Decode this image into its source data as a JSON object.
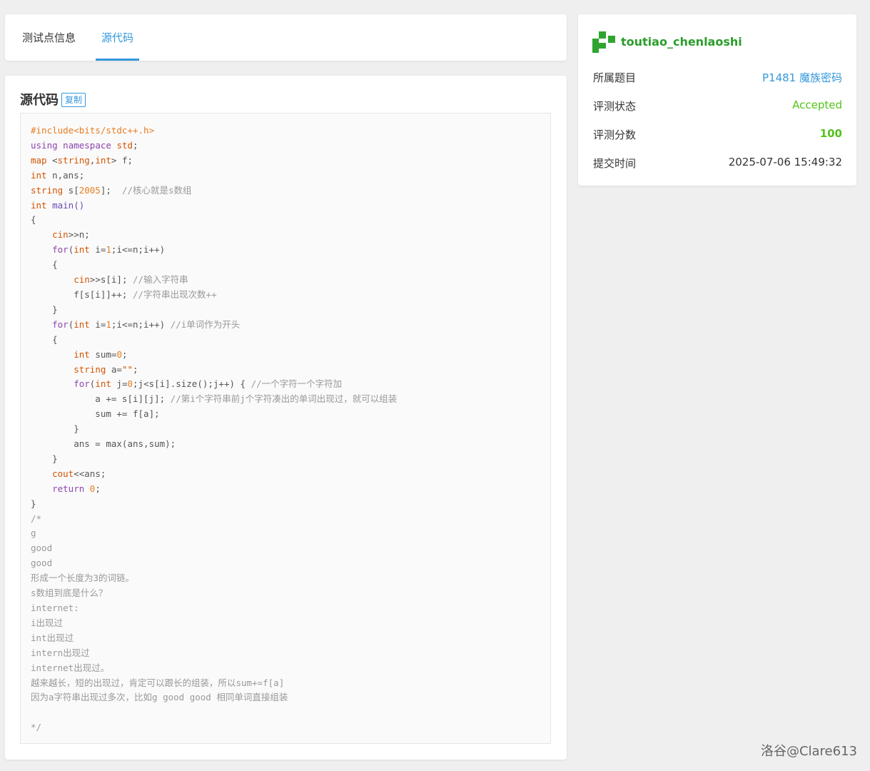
{
  "tabs": [
    {
      "label": "测试点信息"
    },
    {
      "label": "源代码"
    }
  ],
  "source": {
    "title": "源代码",
    "copy_label": "复制"
  },
  "code_lines": [
    [
      [
        "pre",
        "#include<bits/stdc++.h>"
      ]
    ],
    [
      [
        "kw",
        "using"
      ],
      [
        "plain",
        " "
      ],
      [
        "kw",
        "namespace"
      ],
      [
        "plain",
        " "
      ],
      [
        "ty",
        "std"
      ],
      [
        "plain",
        ";"
      ]
    ],
    [
      [
        "ty",
        "map"
      ],
      [
        "plain",
        " <"
      ],
      [
        "ty",
        "string"
      ],
      [
        "plain",
        ","
      ],
      [
        "ty",
        "int"
      ],
      [
        "plain",
        "> f;"
      ]
    ],
    [
      [
        "ty",
        "int"
      ],
      [
        "plain",
        " n,ans;"
      ]
    ],
    [
      [
        "ty",
        "string"
      ],
      [
        "plain",
        " s["
      ],
      [
        "num",
        "2005"
      ],
      [
        "plain",
        "];  "
      ],
      [
        "com",
        "//核心就是s数组"
      ]
    ],
    [
      [
        "ty",
        "int"
      ],
      [
        "plain",
        " "
      ],
      [
        "fn",
        "main()"
      ]
    ],
    [
      [
        "plain",
        "{"
      ]
    ],
    [
      [
        "plain",
        "    "
      ],
      [
        "ty",
        "cin"
      ],
      [
        "plain",
        ">>n;"
      ]
    ],
    [
      [
        "plain",
        "    "
      ],
      [
        "kw",
        "for"
      ],
      [
        "plain",
        "("
      ],
      [
        "ty",
        "int"
      ],
      [
        "plain",
        " i="
      ],
      [
        "num",
        "1"
      ],
      [
        "plain",
        ";i<=n;i++)"
      ]
    ],
    [
      [
        "plain",
        "    {"
      ]
    ],
    [
      [
        "plain",
        "        "
      ],
      [
        "ty",
        "cin"
      ],
      [
        "plain",
        ">>s[i]; "
      ],
      [
        "com",
        "//输入字符串"
      ]
    ],
    [
      [
        "plain",
        "        f[s[i]]++; "
      ],
      [
        "com",
        "//字符串出现次数++"
      ]
    ],
    [
      [
        "plain",
        "    }"
      ]
    ],
    [
      [
        "plain",
        "    "
      ],
      [
        "kw",
        "for"
      ],
      [
        "plain",
        "("
      ],
      [
        "ty",
        "int"
      ],
      [
        "plain",
        " i="
      ],
      [
        "num",
        "1"
      ],
      [
        "plain",
        ";i<=n;i++) "
      ],
      [
        "com",
        "//i单词作为开头"
      ]
    ],
    [
      [
        "plain",
        "    {"
      ]
    ],
    [
      [
        "plain",
        "        "
      ],
      [
        "ty",
        "int"
      ],
      [
        "plain",
        " sum="
      ],
      [
        "num",
        "0"
      ],
      [
        "plain",
        ";"
      ]
    ],
    [
      [
        "plain",
        "        "
      ],
      [
        "ty",
        "string"
      ],
      [
        "plain",
        " a="
      ],
      [
        "str",
        "\"\""
      ],
      [
        "plain",
        ";"
      ]
    ],
    [
      [
        "plain",
        "        "
      ],
      [
        "kw",
        "for"
      ],
      [
        "plain",
        "("
      ],
      [
        "ty",
        "int"
      ],
      [
        "plain",
        " j="
      ],
      [
        "num",
        "0"
      ],
      [
        "plain",
        ";j<s[i].size();j++) { "
      ],
      [
        "com",
        "//一个字符一个字符加"
      ]
    ],
    [
      [
        "plain",
        "            a += s[i][j]; "
      ],
      [
        "com",
        "//第i个字符串前j个字符凑出的单词出现过，就可以组装"
      ]
    ],
    [
      [
        "plain",
        "            sum += f[a];"
      ]
    ],
    [
      [
        "plain",
        "        }"
      ]
    ],
    [
      [
        "plain",
        "        ans = max(ans,sum);"
      ]
    ],
    [
      [
        "plain",
        "    }"
      ]
    ],
    [
      [
        "plain",
        "    "
      ],
      [
        "ty",
        "cout"
      ],
      [
        "plain",
        "<<ans;"
      ]
    ],
    [
      [
        "plain",
        "    "
      ],
      [
        "kw",
        "return"
      ],
      [
        "plain",
        " "
      ],
      [
        "num",
        "0"
      ],
      [
        "plain",
        ";"
      ]
    ],
    [
      [
        "plain",
        "}"
      ]
    ],
    [
      [
        "com",
        "/*"
      ]
    ],
    [
      [
        "com",
        "g"
      ]
    ],
    [
      [
        "com",
        "good"
      ]
    ],
    [
      [
        "com",
        "good"
      ]
    ],
    [
      [
        "com",
        "形成一个长度为3的词链。"
      ]
    ],
    [
      [
        "com",
        "s数组到底是什么？"
      ]
    ],
    [
      [
        "com",
        "internet:"
      ]
    ],
    [
      [
        "com",
        "i出现过"
      ]
    ],
    [
      [
        "com",
        "int出现过"
      ]
    ],
    [
      [
        "com",
        "intern出现过"
      ]
    ],
    [
      [
        "com",
        "internet出现过。"
      ]
    ],
    [
      [
        "com",
        "越来越长，短的出现过，肯定可以跟长的组装，所以sum+=f[a]"
      ]
    ],
    [
      [
        "com",
        "因为a字符串出现过多次，比如g good good 相同单词直接组装"
      ]
    ],
    [
      [
        "com",
        ""
      ]
    ],
    [
      [
        "com",
        "*/"
      ]
    ]
  ],
  "info": {
    "username": "toutiao_chenlaoshi",
    "problem_label": "所属题目",
    "problem_value": "P1481 魔族密码",
    "status_label": "评测状态",
    "status_value": "Accepted",
    "score_label": "评测分数",
    "score_value": "100",
    "time_label": "提交时间",
    "time_value": "2025-07-06 15:49:32"
  },
  "watermark": "洛谷@Clare613",
  "colors": {
    "accent": "#3498db",
    "accepted": "#52c41a",
    "user": "#2a9d2a"
  }
}
